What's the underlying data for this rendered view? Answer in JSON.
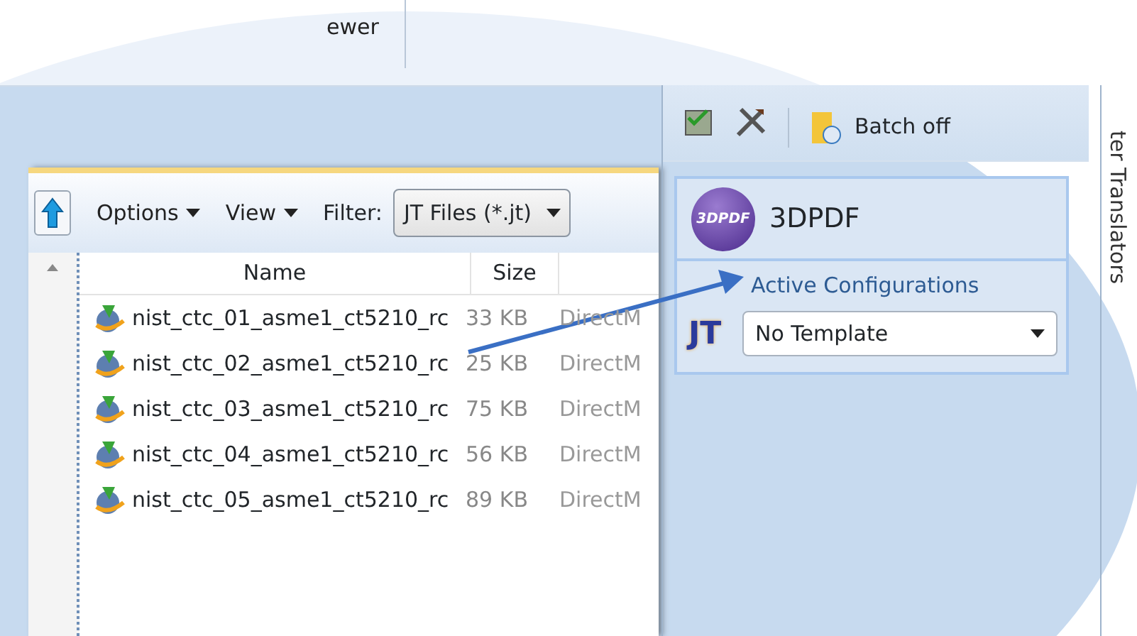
{
  "top_bar": {
    "text": "ewer"
  },
  "file_browser": {
    "menus": [
      {
        "label": "Options"
      },
      {
        "label": "View"
      }
    ],
    "filter_label": "Filter:",
    "filter_value": "JT Files (*.jt)",
    "columns": [
      "Name",
      "Size"
    ],
    "rows": [
      {
        "name": "nist_ctc_01_asme1_ct5210_rc",
        "size": "33 KB",
        "column_3": "DirectM"
      },
      {
        "name": "nist_ctc_02_asme1_ct5210_rc",
        "size": "25 KB",
        "column_3": "DirectM"
      },
      {
        "name": "nist_ctc_03_asme1_ct5210_rc",
        "size": "75 KB",
        "column_3": "DirectM"
      },
      {
        "name": "nist_ctc_04_asme1_ct5210_rc",
        "size": "56 KB",
        "column_3": "DirectM"
      },
      {
        "name": "nist_ctc_05_asme1_ct5210_rc",
        "size": "89 KB",
        "column_3": "DirectM"
      }
    ]
  },
  "translator_panel": {
    "batch_label": "Batch off",
    "card": {
      "logo_text": "3DPDF",
      "title": "3DPDF",
      "section_label": "Active Configurations",
      "format": "JT",
      "template": "No Template"
    }
  },
  "side_tab": {
    "label": "ter Translators"
  }
}
